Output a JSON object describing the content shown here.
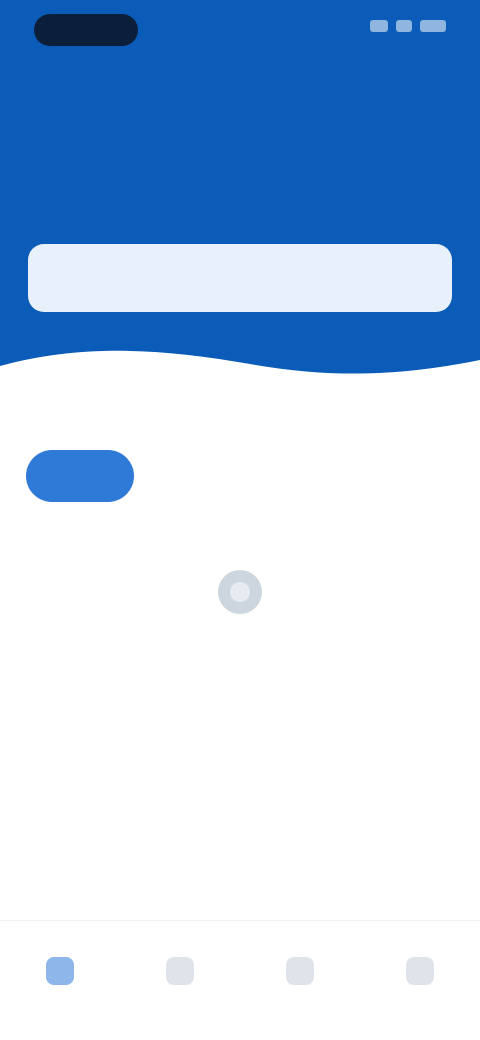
{
  "status_bar": {
    "time": "",
    "indicator_color": "#0b1f3a"
  },
  "hero": {
    "title": "",
    "subtitle": "",
    "background_color": "#0a5cb8"
  },
  "search": {
    "value": "",
    "placeholder": ""
  },
  "section": {
    "label": ""
  },
  "tabs": [
    {
      "label": "",
      "active": true
    },
    {
      "label": "",
      "active": false
    },
    {
      "label": "",
      "active": false
    }
  ],
  "empty_state": {
    "icon": "empty-box-icon",
    "text": ""
  },
  "bottom_nav": [
    {
      "icon": "home-icon",
      "label": "",
      "active": true
    },
    {
      "icon": "grid-icon",
      "label": "",
      "active": false
    },
    {
      "icon": "message-icon",
      "label": "",
      "active": false
    },
    {
      "icon": "profile-icon",
      "label": "",
      "active": false
    }
  ],
  "colors": {
    "accent": "#2f7ad6",
    "search_background": "#e8f0fb"
  }
}
